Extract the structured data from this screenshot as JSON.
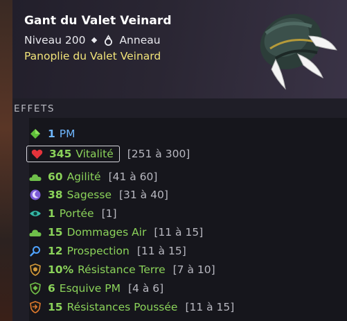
{
  "item": {
    "name": "Gant du Valet Veinard",
    "level": "Niveau 200",
    "type": "Anneau",
    "set": "Panoplie du Valet Veinard"
  },
  "effects_title": "EFFETS",
  "effects": [
    {
      "icon": "pm-diamond-icon",
      "value": "1",
      "label": "PM",
      "range": "",
      "color": "#6fb7ff"
    },
    {
      "icon": "heart-icon",
      "value": "345",
      "label": "Vitalité",
      "range": "[251 à 300]",
      "color": "#8bd35a"
    },
    {
      "icon": "cloud-agility-icon",
      "value": "60",
      "label": "Agilité",
      "range": "[41 à 60]",
      "color": "#8bd35a"
    },
    {
      "icon": "moon-wisdom-icon",
      "value": "38",
      "label": "Sagesse",
      "range": "[31 à 40]",
      "color": "#8bd35a"
    },
    {
      "icon": "eye-range-icon",
      "value": "1",
      "label": "Portée",
      "range": "[1]",
      "color": "#8bd35a"
    },
    {
      "icon": "cloud-air-damage-icon",
      "value": "15",
      "label": "Dommages Air",
      "range": "[11 à 15]",
      "color": "#8bd35a"
    },
    {
      "icon": "magnifier-prospection-icon",
      "value": "12",
      "label": "Prospection",
      "range": "[11 à 15]",
      "color": "#8bd35a"
    },
    {
      "icon": "shield-earth-icon",
      "value": "10%",
      "label": "Résistance Terre",
      "range": "[7 à 10]",
      "color": "#8bd35a"
    },
    {
      "icon": "shield-dodge-pm-icon",
      "value": "6",
      "label": "Esquive PM",
      "range": "[4 à 6]",
      "color": "#8bd35a"
    },
    {
      "icon": "shield-pushback-icon",
      "value": "15",
      "label": "Résistances Poussée",
      "range": "[11 à 15]",
      "color": "#8bd35a"
    }
  ]
}
